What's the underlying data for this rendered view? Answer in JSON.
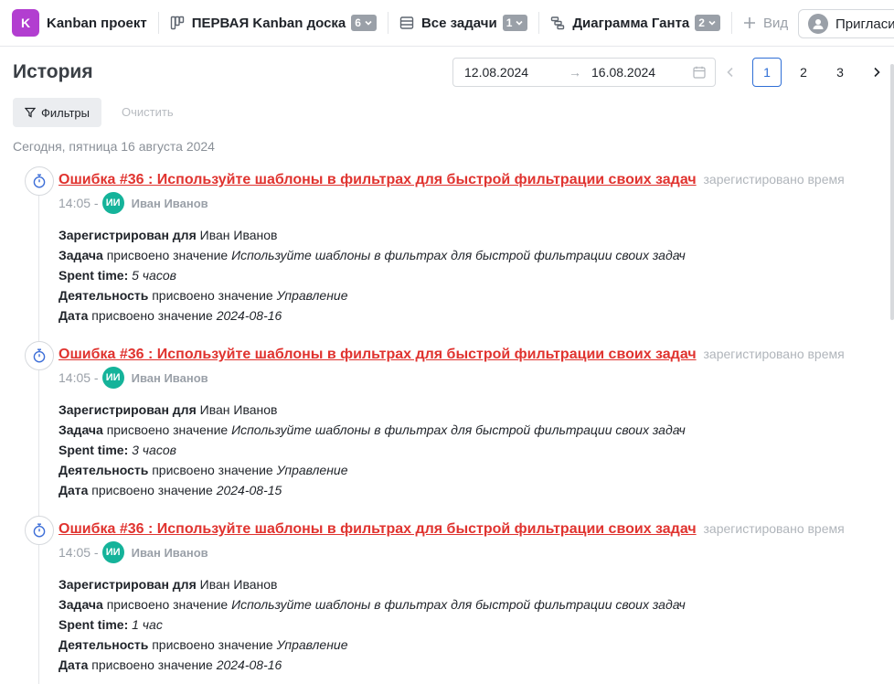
{
  "project": {
    "initial": "K",
    "name": "Kanban проект"
  },
  "nav": {
    "tabs": [
      {
        "label": "ПЕРВАЯ Kanban доска",
        "count": "6",
        "icon": "board-icon"
      },
      {
        "label": "Все задачи",
        "count": "1",
        "icon": "list-icon"
      },
      {
        "label": "Диаграмма Ганта",
        "count": "2",
        "icon": "gantt-icon"
      }
    ],
    "add_view_label": "Вид",
    "invite_label": "Пригласить"
  },
  "page": {
    "title": "История"
  },
  "date_range": {
    "start": "12.08.2024",
    "arrow": "→",
    "end": "16.08.2024"
  },
  "pagination": {
    "pages": [
      "1",
      "2",
      "3"
    ],
    "current": "1",
    "prev": "‹",
    "next": "›"
  },
  "filters": {
    "filters_label": "Фильтры",
    "clear_label": "Очистить"
  },
  "day_header": "Сегодня, пятница 16 августа 2024",
  "entries": [
    {
      "title": "Ошибка #36 : Используйте шаблоны в фильтрах для быстрой фильтрации своих задач",
      "action": "зарегистировано время",
      "time": "14:05 -",
      "user_initials": "ИИ",
      "user_name": "Иван Иванов",
      "details": {
        "registered_label": "Зарегистрирован для",
        "registered_value": "Иван Иванов",
        "task_label": "Задача",
        "task_verb": "присвоено значение",
        "task_value": "Используйте шаблоны в фильтрах для быстрой фильтрации своих задач",
        "spent_label": "Spent time:",
        "spent_value": "5 часов",
        "activity_label": "Деятельность",
        "activity_verb": "присвоено значение",
        "activity_value": "Управление",
        "date_label": "Дата",
        "date_verb": "присвоено значение",
        "date_value": "2024-08-16"
      }
    },
    {
      "title": "Ошибка #36 : Используйте шаблоны в фильтрах для быстрой фильтрации своих задач",
      "action": "зарегистировано время",
      "time": "14:05 -",
      "user_initials": "ИИ",
      "user_name": "Иван Иванов",
      "details": {
        "registered_label": "Зарегистрирован для",
        "registered_value": "Иван Иванов",
        "task_label": "Задача",
        "task_verb": "присвоено значение",
        "task_value": "Используйте шаблоны в фильтрах для быстрой фильтрации своих задач",
        "spent_label": "Spent time:",
        "spent_value": "3 часов",
        "activity_label": "Деятельность",
        "activity_verb": "присвоено значение",
        "activity_value": "Управление",
        "date_label": "Дата",
        "date_verb": "присвоено значение",
        "date_value": "2024-08-15"
      }
    },
    {
      "title": "Ошибка #36 : Используйте шаблоны в фильтрах для быстрой фильтрации своих задач",
      "action": "зарегистировано время",
      "time": "14:05 -",
      "user_initials": "ИИ",
      "user_name": "Иван Иванов",
      "details": {
        "registered_label": "Зарегистрирован для",
        "registered_value": "Иван Иванов",
        "task_label": "Задача",
        "task_verb": "присвоено значение",
        "task_value": "Используйте шаблоны в фильтрах для быстрой фильтрации своих задач",
        "spent_label": "Spent time:",
        "spent_value": "1 час",
        "activity_label": "Деятельность",
        "activity_verb": "присвоено значение",
        "activity_value": "Управление",
        "date_label": "Дата",
        "date_verb": "присвоено значение",
        "date_value": "2024-08-16"
      }
    }
  ],
  "colors": {
    "accent": "#2f6fd6",
    "link_red": "#e0332f",
    "avatar_teal": "#15b39a",
    "project_purple": "#b23ed0"
  }
}
